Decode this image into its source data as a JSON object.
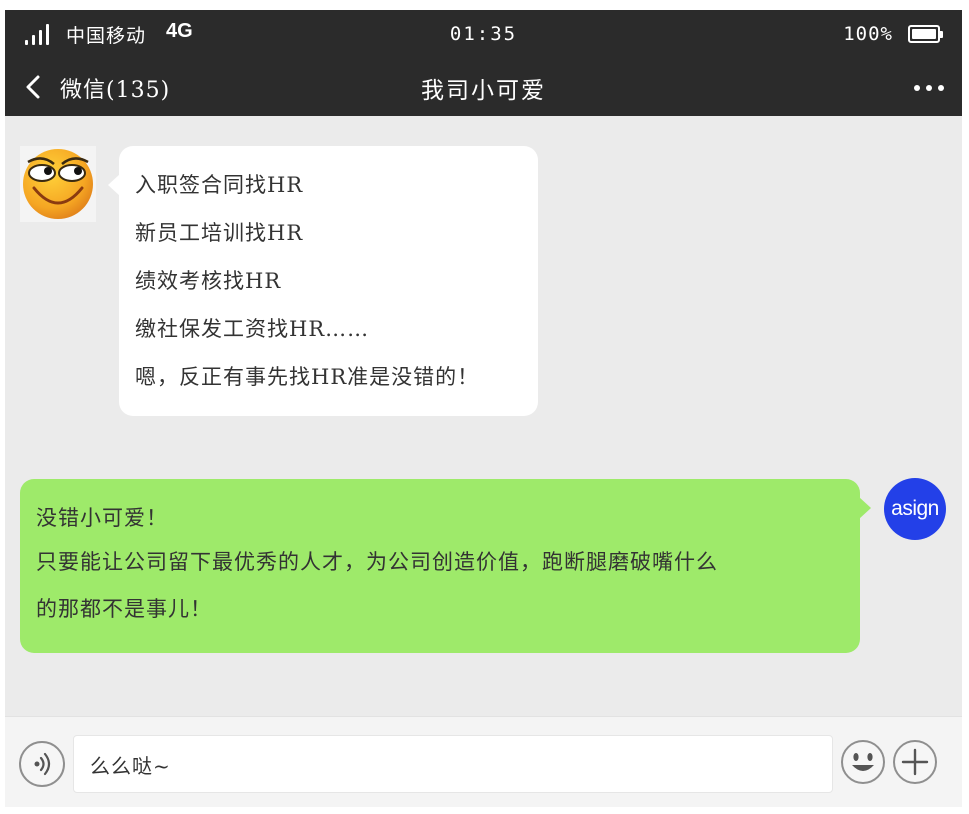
{
  "status_bar": {
    "carrier": "中国移动",
    "network": "4G",
    "time": "01:35",
    "battery_percent": "100%",
    "icons": [
      "signal-icon",
      "battery-icon"
    ]
  },
  "nav": {
    "back_label": "微信(135)",
    "title": "我司小可爱",
    "icons": [
      "chevron-left-icon",
      "more-icon"
    ]
  },
  "messages": [
    {
      "side": "left",
      "avatar": "smiley-face-avatar",
      "lines": [
        "入职签合同找HR",
        "新员工培训找HR",
        "绩效考核找HR",
        "缴社保发工资找HR……",
        "嗯，反正有事先找HR准是没错的！"
      ]
    },
    {
      "side": "right",
      "avatar_text": "asign",
      "lines": [
        "没错小可爱！",
        "只要能让公司留下最优秀的人才，为公司创造价值，跑断腿磨破嘴什么",
        "的那都不是事儿！"
      ]
    }
  ],
  "input_bar": {
    "value": "么么哒~",
    "icons": [
      "voice-icon",
      "emoji-icon",
      "plus-icon"
    ]
  },
  "colors": {
    "header_bg": "#2b2b2b",
    "chat_bg": "#ebebeb",
    "bubble_left": "#ffffff",
    "bubble_right": "#9eea6a",
    "avatar_right": "#2340e8"
  }
}
